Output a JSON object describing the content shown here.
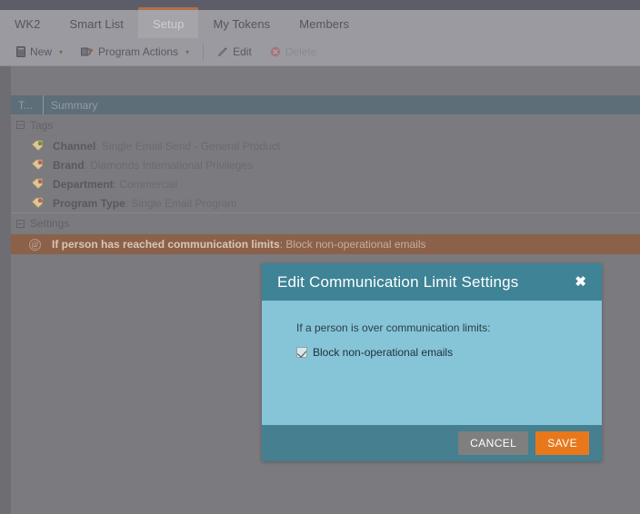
{
  "colors": {
    "top_strip": "#5d5c69",
    "tab_bar": "#9b9aa0",
    "active_tab_accent": "#b0714a",
    "grid_header": "#5e6e78",
    "selected_row": "#8c6149",
    "modal_header": "#3e8396",
    "modal_body": "#86c4d8",
    "modal_footer": "#457f90",
    "save_button": "#e8781b",
    "cancel_button": "#7f7f7f"
  },
  "tabs": [
    {
      "label": "WK2",
      "active": false
    },
    {
      "label": "Smart List",
      "active": false
    },
    {
      "label": "Setup",
      "active": true
    },
    {
      "label": "My Tokens",
      "active": false
    },
    {
      "label": "Members",
      "active": false
    }
  ],
  "toolbar": {
    "new_label": "New",
    "new_icon": "new-document-icon",
    "program_actions_label": "Program Actions",
    "program_actions_icon": "program-actions-icon",
    "edit_label": "Edit",
    "edit_icon": "pencil-icon",
    "delete_label": "Delete",
    "delete_icon": "delete-x-icon",
    "caret": "▾"
  },
  "grid": {
    "columns": [
      {
        "label": "T..."
      },
      {
        "label": "Summary"
      }
    ],
    "groups": [
      {
        "name": "Tags",
        "rows": [
          {
            "icon": "tag-icon-green",
            "label": "Channel",
            "value": "Single Email Send - General Product",
            "selected": false
          },
          {
            "icon": "tag-icon-red",
            "label": "Brand",
            "value": "Diamonds International Privileges",
            "selected": false
          },
          {
            "icon": "tag-icon-red",
            "label": "Department",
            "value": "Commercial",
            "selected": false
          },
          {
            "icon": "tag-icon-red",
            "label": "Program Type",
            "value": "Single Email Program",
            "selected": false
          }
        ]
      },
      {
        "name": "Settings",
        "rows": [
          {
            "icon": "at-icon",
            "label": "If person has reached communication limits",
            "value": "Block non-operational emails",
            "selected": true
          }
        ]
      }
    ]
  },
  "modal": {
    "title": "Edit Communication Limit Settings",
    "close_icon": "✖",
    "body_label": "If a person is over communication limits:",
    "checkbox_label": "Block non-operational emails",
    "checkbox_checked": true,
    "cancel_label": "CANCEL",
    "save_label": "SAVE"
  }
}
